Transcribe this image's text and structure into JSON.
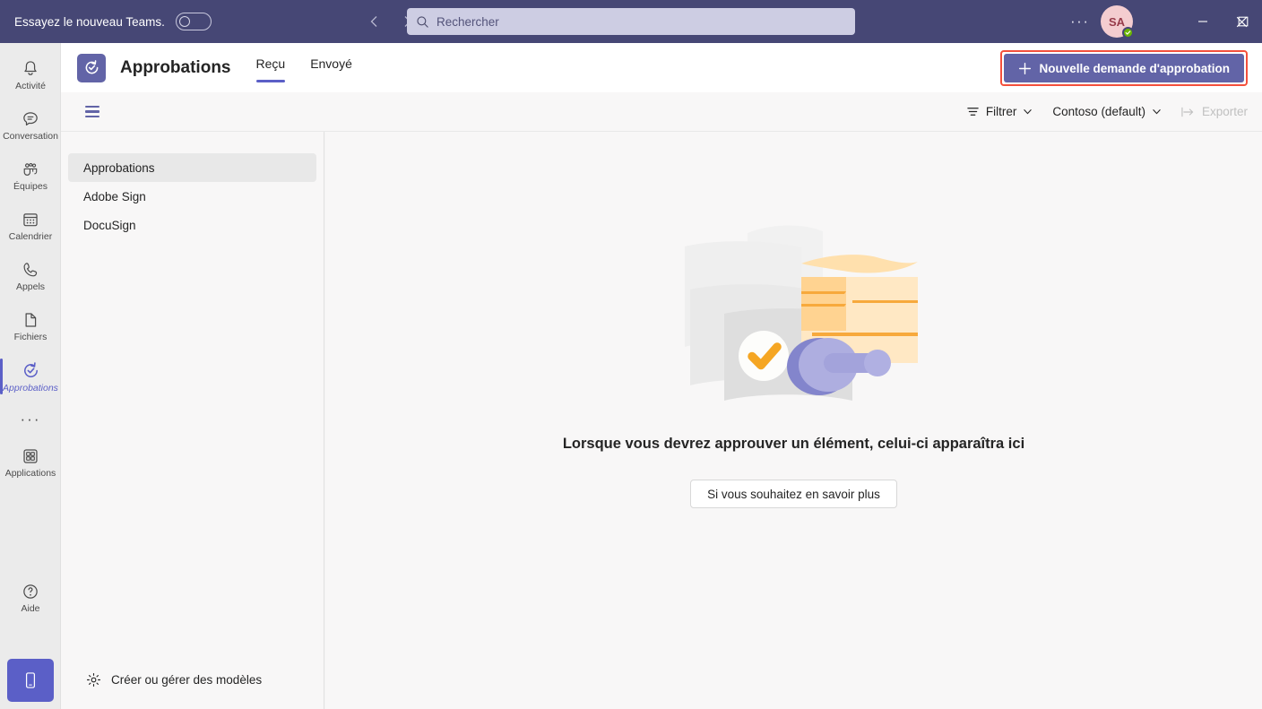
{
  "titlebar": {
    "try_new_teams_label": "Essayez le nouveau Teams.",
    "toggle_state": "off",
    "search_placeholder": "Rechercher",
    "search_value": "",
    "more_options": "···",
    "avatar_initials": "SA",
    "presence": "available",
    "minimize_glyph": "—",
    "maximize_glyph": "□",
    "close_glyph": "✕",
    "background_color": "#464775"
  },
  "rail": {
    "items": [
      {
        "label": "Activité",
        "icon": "bell-icon",
        "active": false
      },
      {
        "label": "Conversation",
        "icon": "chat-icon",
        "active": false
      },
      {
        "label": "Équipes",
        "icon": "teams-icon",
        "active": false
      },
      {
        "label": "Calendrier",
        "icon": "calendar-icon",
        "active": false
      },
      {
        "label": "Appels",
        "icon": "phone-icon",
        "active": false
      },
      {
        "label": "Fichiers",
        "icon": "file-icon",
        "active": false
      },
      {
        "label": "Approbations",
        "icon": "approvals-icon",
        "active": true
      }
    ],
    "more_glyph": "···",
    "apps_label": "Applications",
    "help_label": "Aide",
    "mobile_download_icon": "mobile-phone-icon",
    "accent_color": "#5b5fc7"
  },
  "app_header": {
    "app_icon": "approvals-app-icon",
    "title": "Approbations",
    "tabs": [
      {
        "label": "Reçu",
        "active": true
      },
      {
        "label": "Envoyé",
        "active": false
      }
    ],
    "new_request_label": "Nouvelle demande d'approbation",
    "new_request_plus": "+",
    "highlight_color": "#f4503c",
    "button_color": "#6264a7"
  },
  "toolbar": {
    "list_view_icon": "hamburger-list-icon",
    "filter_label": "Filtrer",
    "tenant_label": "Contoso (default)",
    "export_label": "Exporter",
    "export_disabled": true
  },
  "left_panel": {
    "items": [
      {
        "label": "Approbations",
        "selected": true
      },
      {
        "label": "Adobe Sign",
        "selected": false
      },
      {
        "label": "DocuSign",
        "selected": false
      }
    ],
    "manage_templates_label": "Créer ou gérer des modèles",
    "manage_templates_icon": "gear-icon"
  },
  "main": {
    "illustration": "approvals-empty-state-illustration",
    "empty_title": "Lorsque vous devrez approuver un élément, celui-ci apparaîtra ici",
    "learn_more_label": "Si vous souhaitez en savoir plus"
  }
}
